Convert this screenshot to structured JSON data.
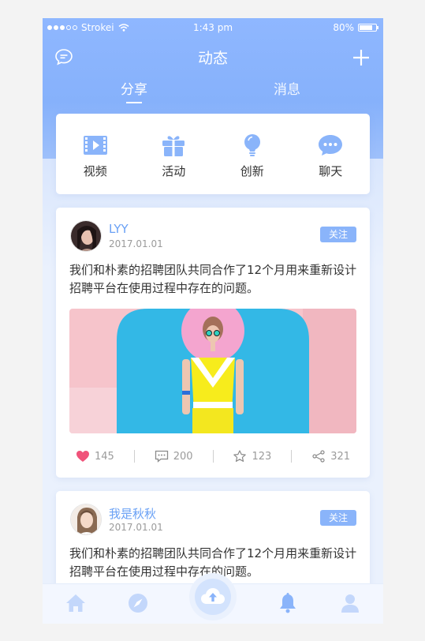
{
  "status_bar": {
    "carrier": "Strokei",
    "time": "1:43 pm",
    "battery": "80%",
    "battery_level": 0.8
  },
  "nav": {
    "title": "动态",
    "left_icon": "chat-bubble-icon",
    "right_icon": "plus-icon"
  },
  "tabs": [
    {
      "label": "分享",
      "active": true
    },
    {
      "label": "消息",
      "active": false
    }
  ],
  "categories": [
    {
      "label": "视频",
      "icon": "video-icon"
    },
    {
      "label": "活动",
      "icon": "gift-icon"
    },
    {
      "label": "创新",
      "icon": "lightbulb-icon"
    },
    {
      "label": "聊天",
      "icon": "chat-icon"
    }
  ],
  "posts": [
    {
      "username": "LYY",
      "date": "2017.01.01",
      "follow_label": "关注",
      "text": "我们和朴素的招聘团队共同合作了12个月用来重新设计招聘平台在使用过程中存在的问题。",
      "likes": "145",
      "comments": "200",
      "stars": "123",
      "shares": "321"
    },
    {
      "username": "我是秋秋",
      "date": "2017.01.01",
      "follow_label": "关注",
      "text": "我们和朴素的招聘团队共同合作了12个月用来重新设计招聘平台在使用过程中存在的问题。"
    }
  ],
  "tabbar": {
    "items": [
      "home-icon",
      "compass-icon",
      "upload-icon",
      "bell-icon",
      "profile-icon"
    ]
  },
  "colors": {
    "accent": "#8ab4fa",
    "header": "#8fb7ff",
    "like": "#f0537a"
  }
}
